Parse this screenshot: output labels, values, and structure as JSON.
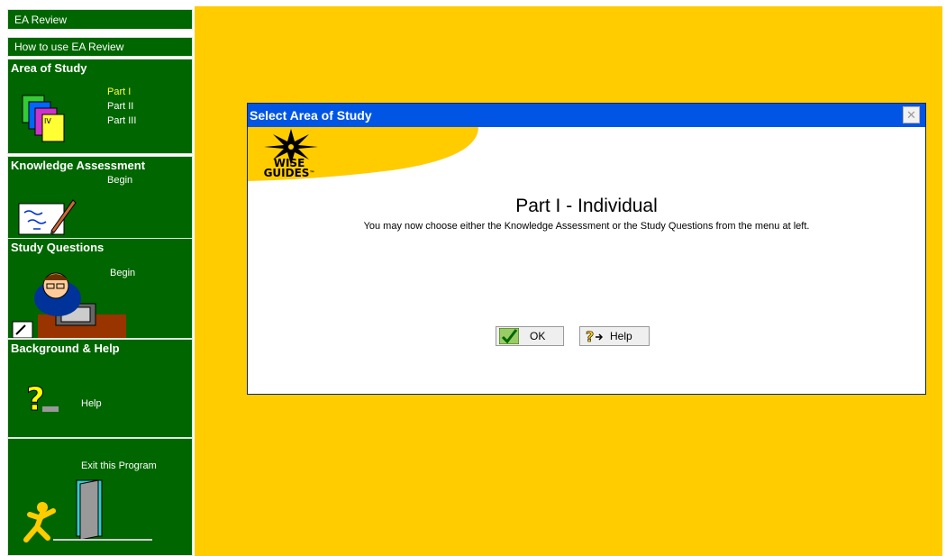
{
  "sidebar": {
    "ea_review": "EA Review",
    "how_to_use": "How to use EA Review",
    "area_of_study": {
      "header": "Area of Study",
      "items": [
        "Part I",
        "Part II",
        "Part III"
      ],
      "selected": "Part I"
    },
    "knowledge_assessment": {
      "header": "Knowledge Assessment",
      "action": "Begin"
    },
    "study_questions": {
      "header": "Study Questions",
      "action": "Begin"
    },
    "background_help": {
      "header": "Background & Help",
      "action": "Help"
    },
    "exit": {
      "label": "Exit this Program"
    }
  },
  "dialog": {
    "title": "Select Area of Study",
    "close_glyph": "✕",
    "logo": {
      "line1": "WISE",
      "line2": "GUIDES",
      "tm": "™"
    },
    "heading": "Part I - Individual",
    "message": "You may now choose either the Knowledge Assessment or the Study Questions from the menu at left.",
    "ok_label": "OK",
    "help_label": "Help"
  },
  "icons": {
    "folders": "folders-icon",
    "assessment": "pen-paper-icon",
    "study": "student-desk-icon",
    "help": "question-mark-icon",
    "exit": "running-man-door-icon",
    "ok": "checkmark-icon",
    "help_button": "question-arrow-icon",
    "logo": "eye-sunburst-icon"
  },
  "colors": {
    "sidebar_green": "#006600",
    "workspace_yellow": "#ffcc00",
    "titlebar_blue": "#0055e5",
    "selected_link": "#ffff33"
  }
}
